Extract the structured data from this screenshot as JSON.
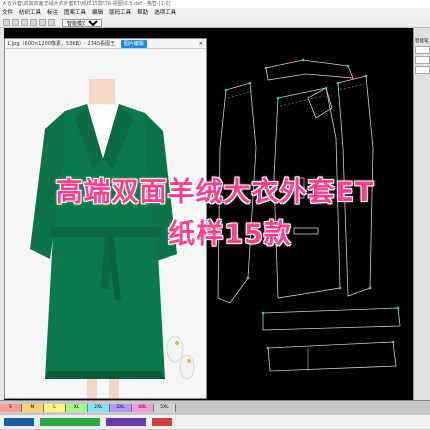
{
  "window": {
    "title": "大衣外套\\高端双面羊绒大衣外套ET\\纸样15款\\TR-视图\\0.5.dxf - 格智-[1.0]"
  },
  "menu": {
    "items": [
      "文件",
      "纺织工具",
      "标注",
      "图案工具",
      "编辑",
      "版码工具",
      "帮助",
      "选项工具"
    ]
  },
  "toolbar": {
    "mode_select": "智能模式(F9)"
  },
  "image_window": {
    "tab_title": "1.jpg（600×1200像素，53KB）- 2345看图王",
    "tab_button": "图片编辑",
    "close": "✕"
  },
  "overlay": {
    "line1": "高端双面羊绒大衣外套ET",
    "line2": "纸样15款"
  },
  "right_panel": {
    "label": "智能笔"
  },
  "bottom": {
    "sizes": [
      "S",
      "M",
      "L",
      "XL",
      "2XL",
      "3XL",
      "4XL",
      "5XL"
    ],
    "size_colors": [
      "#ff9a9a",
      "#ffd27a",
      "#fff57a",
      "#a8f58a",
      "#8ae0f5",
      "#b59af5",
      "#f59ae0",
      "#d0d0d0"
    ]
  },
  "colors": {
    "coat": "#0a7a4a",
    "pattern_line": "#cfcfcf",
    "pattern_marks": "#2ee36a",
    "overlay_text": "#ff3e8c"
  }
}
